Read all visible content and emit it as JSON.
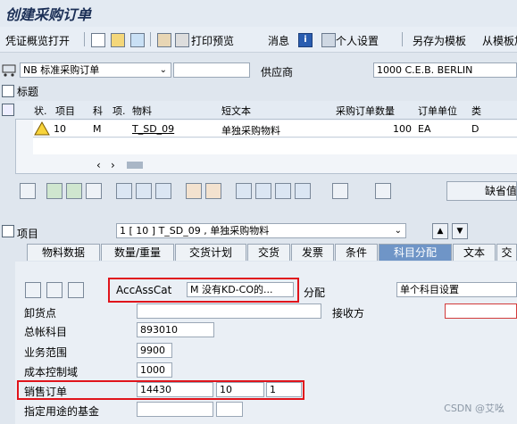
{
  "title": "创建采购订单",
  "toolbar": {
    "doc_overview": "凭证概览打开",
    "print_preview": "打印预览",
    "messages": "消息",
    "personal_settings": "个人设置",
    "save_template": "另存为模板",
    "load_template": "从模板加"
  },
  "header": {
    "order_type": "NB 标准采购订单",
    "vendor_label": "供应商",
    "vendor_value": "1000 C.E.B. BERLIN",
    "header_label": "标题"
  },
  "grid": {
    "columns": [
      "状.",
      "项目",
      "科",
      "项.",
      "物料",
      "短文本",
      "采购订单数量",
      "订单单位",
      "类"
    ],
    "row": {
      "item": "10",
      "acct": "M",
      "material": "T_SD_09",
      "short_text": "单独采购物料",
      "qty": "100",
      "unit": "EA",
      "cat": "D"
    }
  },
  "default_button": "缺省值",
  "item_section": {
    "label": "项目",
    "selected_item": "1 [ 10 ] T_SD_09 , 单独采购物料"
  },
  "tabs": [
    "物料数据",
    "数量/重量",
    "交货计划",
    "交货",
    "发票",
    "条件",
    "科目分配",
    "文本",
    "交"
  ],
  "account": {
    "acc_ass_cat_label": "AccAssCat",
    "acc_ass_cat_value": "M 没有KD-CO的...",
    "distribution_label": "分配",
    "single_setting": "单个科目设置",
    "unloading_point": "卸货点",
    "recipient": "接收方",
    "gl_account_label": "总帐科目",
    "gl_account_value": "893010",
    "business_area_label": "业务范围",
    "business_area_value": "9900",
    "co_area_label": "成本控制域",
    "co_area_value": "1000",
    "sales_order_label": "销售订单",
    "sales_order_value": "14430",
    "sales_item": "10",
    "sales_schedule": "1",
    "fund_label": "指定用途的基金"
  },
  "watermark": "CSDN @艾吆"
}
